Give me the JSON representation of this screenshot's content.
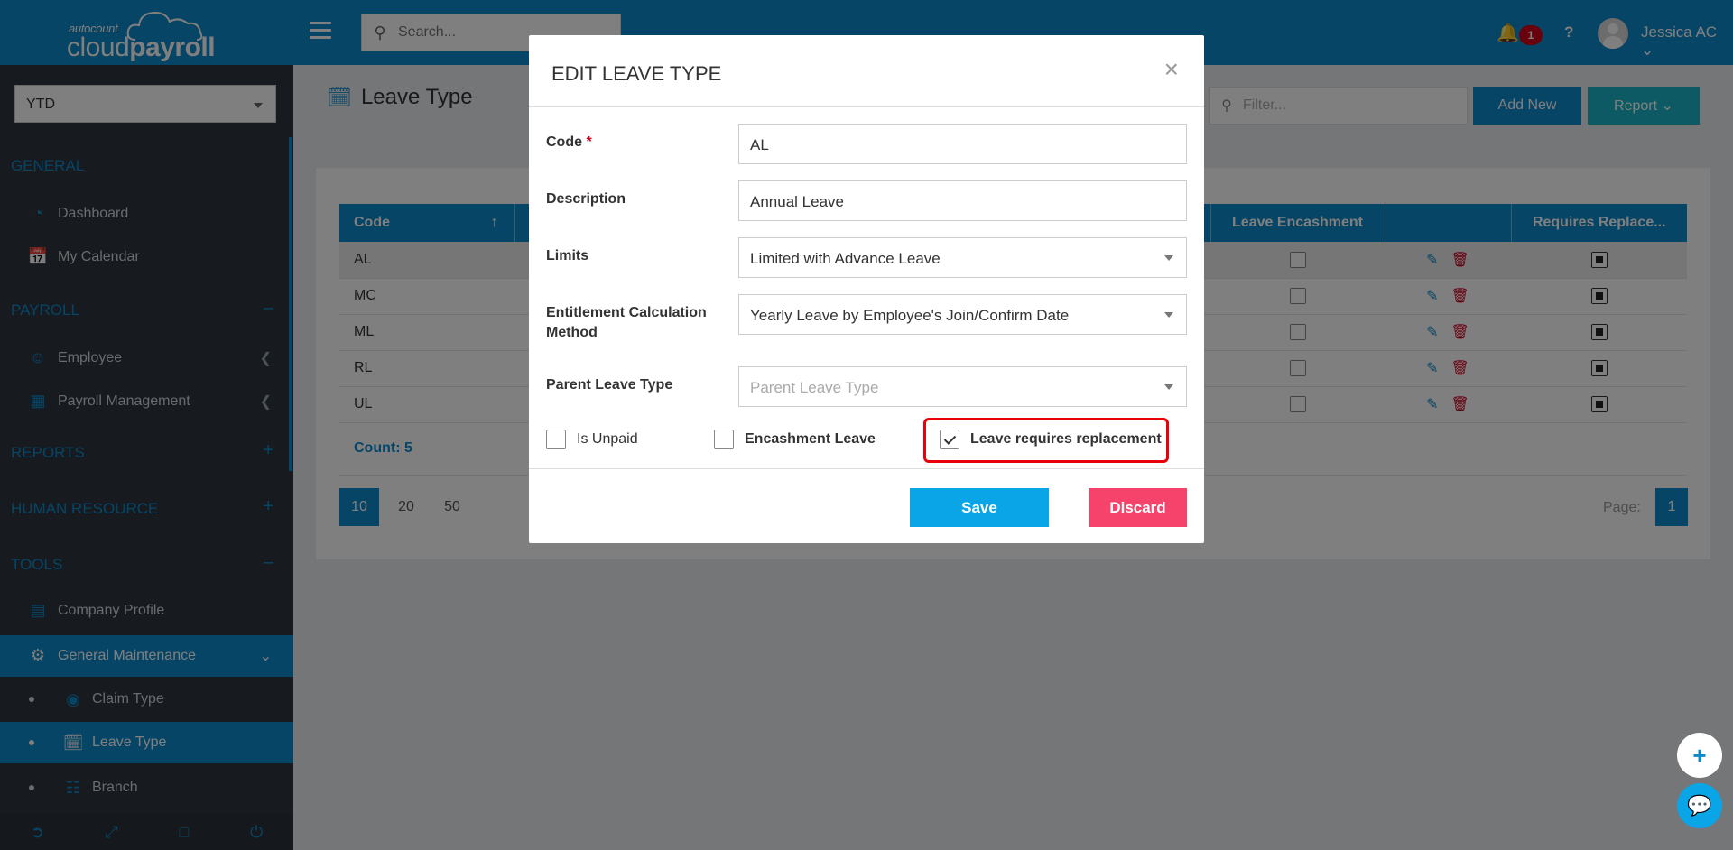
{
  "app": {
    "logo_small": "autocount",
    "logo_big_light": "cloud",
    "logo_big_bold": "payroll"
  },
  "topbar": {
    "search_placeholder": "Search...",
    "notification_count": "1",
    "help": "?",
    "user_name": "Jessica AC"
  },
  "sidebar": {
    "period": "YTD",
    "sections": {
      "general": "GENERAL",
      "payroll": "PAYROLL",
      "reports": "REPORTS",
      "hr": "HUMAN RESOURCE",
      "tools": "TOOLS"
    },
    "items": {
      "dashboard": "Dashboard",
      "calendar": "My Calendar",
      "employee": "Employee",
      "payroll_mgmt": "Payroll Management",
      "company_profile": "Company Profile",
      "general_maintenance": "General Maintenance",
      "claim_type": "Claim Type",
      "leave_type": "Leave Type",
      "branch": "Branch"
    }
  },
  "page": {
    "title": "Leave Type",
    "filter_placeholder": "Filter...",
    "add_new": "Add New",
    "report": "Report"
  },
  "table": {
    "headers": {
      "code": "Code",
      "leave_encashment": "Leave Encashment",
      "requires_replacement": "Requires Replace..."
    },
    "rows": [
      {
        "code": "AL"
      },
      {
        "code": "MC"
      },
      {
        "code": "ML"
      },
      {
        "code": "RL"
      },
      {
        "code": "UL"
      }
    ],
    "count": "Count: 5"
  },
  "pagination": {
    "sizes": [
      "10",
      "20",
      "50"
    ],
    "page_label": "Page:",
    "page": "1"
  },
  "modal": {
    "title": "EDIT LEAVE TYPE",
    "close": "×",
    "labels": {
      "code": "Code",
      "required": "*",
      "description": "Description",
      "limits": "Limits",
      "entitlement": "Entitlement Calculation Method",
      "parent": "Parent Leave Type"
    },
    "values": {
      "code": "AL",
      "description": "Annual Leave",
      "limits": "Limited with Advance Leave",
      "entitlement": "Yearly Leave by Employee's Join/Confirm Date",
      "parent_placeholder": "Parent Leave Type"
    },
    "checkboxes": {
      "is_unpaid": "Is Unpaid",
      "encashment": "Encashment Leave",
      "replacement": "Leave requires replacement"
    },
    "save": "Save",
    "discard": "Discard"
  },
  "colors": {
    "primary": "#0d8acb",
    "teal": "#1bb5c9",
    "save": "#0aa5e6",
    "discard": "#f5436b",
    "highlight": "#e8000b"
  }
}
